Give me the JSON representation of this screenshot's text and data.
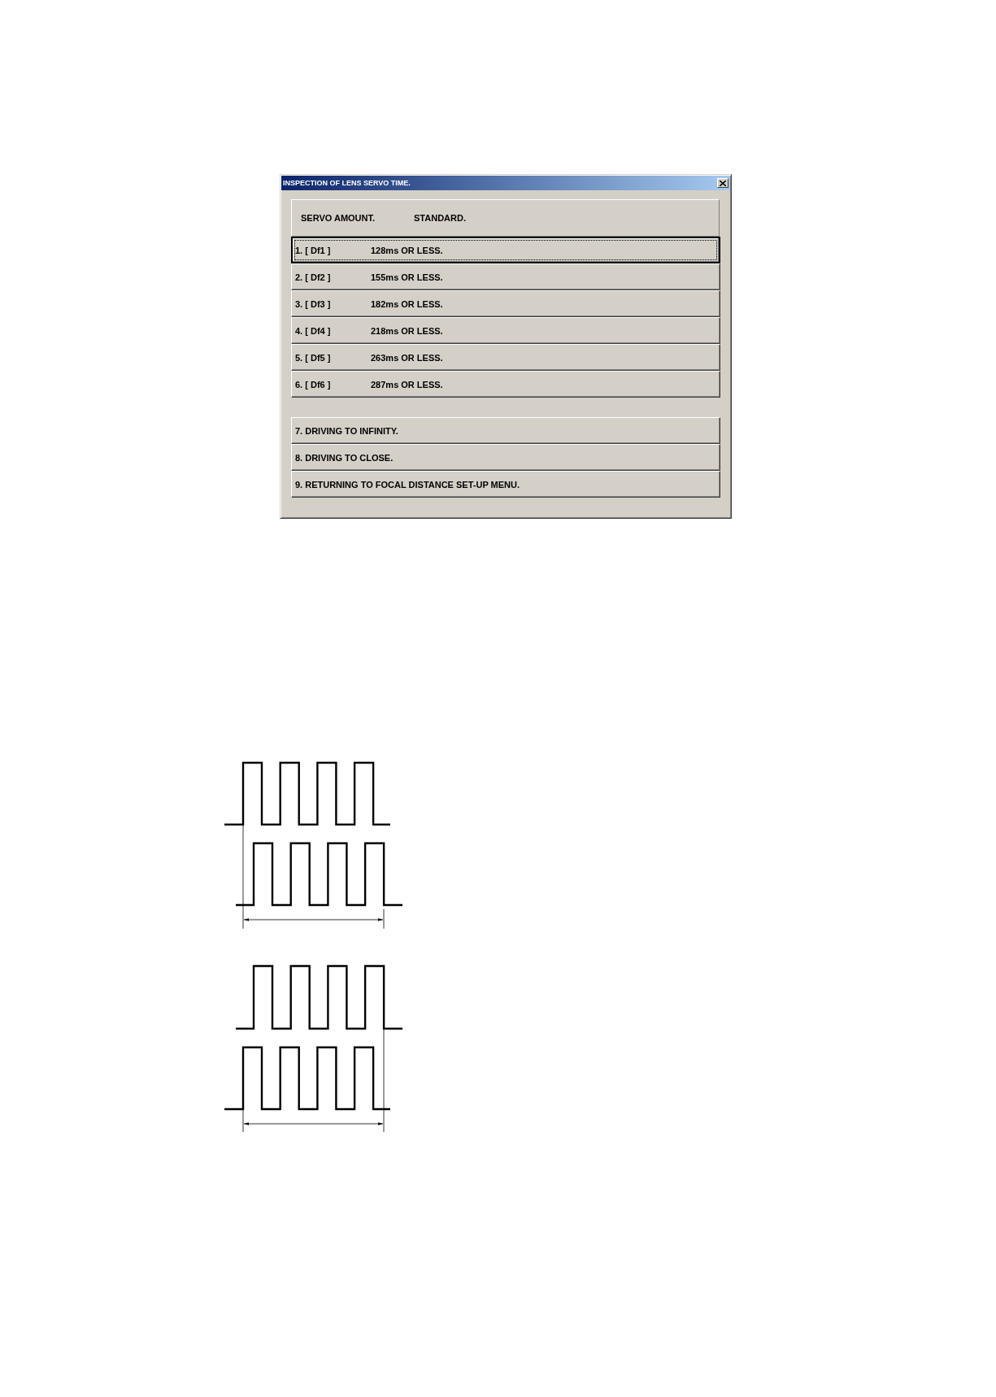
{
  "window": {
    "title": "INSPECTION OF LENS SERVO TIME."
  },
  "header": {
    "column_1": "SERVO AMOUNT.",
    "column_2": "STANDARD."
  },
  "rows": [
    {
      "label": "1. [ Df1 ]",
      "value": "128ms OR LESS.",
      "selected": true
    },
    {
      "label": "2. [ Df2 ]",
      "value": "155ms OR LESS.",
      "selected": false
    },
    {
      "label": "3. [ Df3 ]",
      "value": "182ms OR LESS.",
      "selected": false
    },
    {
      "label": "4. [ Df4 ]",
      "value": "218ms OR LESS.",
      "selected": false
    },
    {
      "label": "5. [ Df5 ]",
      "value": "263ms OR LESS.",
      "selected": false
    },
    {
      "label": "6. [ Df6 ]",
      "value": "287ms OR LESS.",
      "selected": false
    }
  ],
  "actions": [
    {
      "label": "7. DRIVING TO INFINITY.",
      "selected": false
    },
    {
      "label": "8. DRIVING TO CLOSE.",
      "selected": false
    },
    {
      "label": "9. RETURNING TO FOCAL DISTANCE SET-UP MENU.",
      "selected": false
    }
  ],
  "timing_diagrams": [
    {
      "top_wave_leads": true
    },
    {
      "top_wave_leads": false
    }
  ]
}
